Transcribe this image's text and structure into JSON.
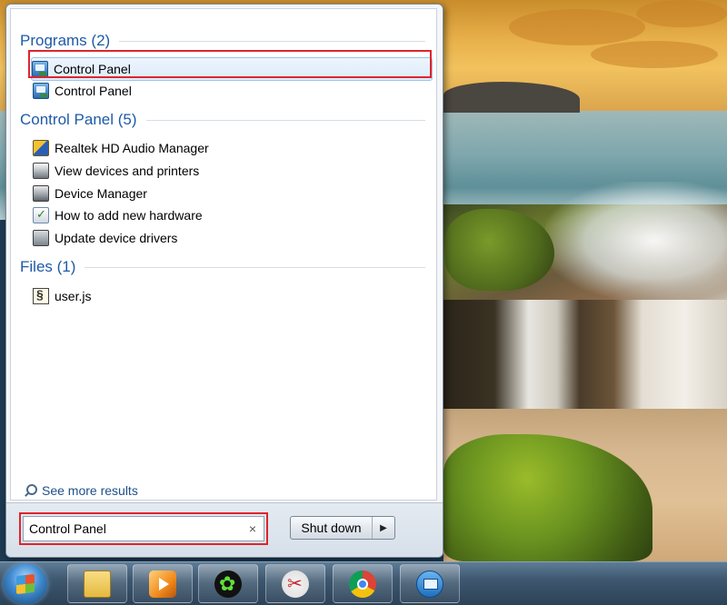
{
  "start_menu": {
    "groups": [
      {
        "title": "Programs (2)",
        "items": [
          {
            "label": "Control Panel",
            "icon": "control-panel-icon",
            "selected": true
          },
          {
            "label": "Control Panel",
            "icon": "control-panel-icon"
          }
        ]
      },
      {
        "title": "Control Panel (5)",
        "items": [
          {
            "label": "Realtek HD Audio Manager",
            "icon": "realtek-audio-icon"
          },
          {
            "label": "View devices and printers",
            "icon": "printer-icon"
          },
          {
            "label": "Device Manager",
            "icon": "device-manager-icon"
          },
          {
            "label": "How to add new hardware",
            "icon": "add-hardware-icon"
          },
          {
            "label": "Update device drivers",
            "icon": "update-drivers-icon"
          }
        ]
      },
      {
        "title": "Files (1)",
        "items": [
          {
            "label": "user.js",
            "icon": "script-file-icon"
          }
        ]
      }
    ],
    "see_more": "See more results",
    "search": {
      "value": "Control Panel",
      "clear_glyph": "×"
    },
    "shutdown": {
      "label": "Shut down",
      "arrow_glyph": "▶"
    }
  },
  "taskbar": {
    "buttons": [
      {
        "icon": "windows-explorer-icon"
      },
      {
        "icon": "media-player-icon"
      },
      {
        "icon": "clover-app-icon"
      },
      {
        "icon": "snipping-tool-icon"
      },
      {
        "icon": "chrome-icon"
      },
      {
        "icon": "remote-desktop-icon"
      }
    ]
  },
  "colors": {
    "accent_header": "#1e5aa8",
    "highlight_box": "#e0242c",
    "taskbar": "#3e5870"
  }
}
